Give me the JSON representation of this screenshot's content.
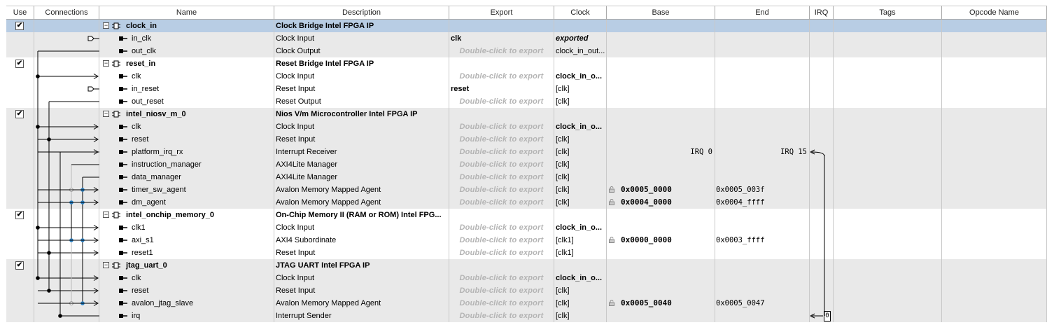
{
  "headers": {
    "use": "Use",
    "connections": "Connections",
    "name": "Name",
    "description": "Description",
    "export": "Export",
    "clock": "Clock",
    "base": "Base",
    "end": "End",
    "irq": "IRQ",
    "tags": "Tags",
    "opcode": "Opcode Name"
  },
  "export_hint": "Double-click to export",
  "rows": [
    {
      "kind": "comp",
      "name": "clock_in",
      "desc": "Clock Bridge Intel FPGA IP",
      "export": "",
      "clock": "",
      "base": "",
      "end": "",
      "checked": true,
      "selected": true
    },
    {
      "kind": "port",
      "name": "in_clk",
      "desc": "Clock Input",
      "export": "clk",
      "clock": "exported",
      "base": "",
      "end": ""
    },
    {
      "kind": "port",
      "name": "out_clk",
      "desc": "Clock Output",
      "export": "",
      "clock": "clock_in_out...",
      "base": "",
      "end": ""
    },
    {
      "kind": "comp",
      "name": "reset_in",
      "desc": "Reset Bridge Intel FPGA IP",
      "export": "",
      "clock": "",
      "base": "",
      "end": "",
      "checked": true
    },
    {
      "kind": "port",
      "name": "clk",
      "desc": "Clock Input",
      "export": "",
      "clock": "clock_in_o...",
      "base": "",
      "end": ""
    },
    {
      "kind": "port",
      "name": "in_reset",
      "desc": "Reset Input",
      "export": "reset",
      "clock": "[clk]",
      "base": "",
      "end": ""
    },
    {
      "kind": "port",
      "name": "out_reset",
      "desc": "Reset Output",
      "export": "",
      "clock": "[clk]",
      "base": "",
      "end": ""
    },
    {
      "kind": "comp",
      "name": "intel_niosv_m_0",
      "desc": "Nios V/m Microcontroller Intel FPGA IP",
      "export": "",
      "clock": "",
      "base": "",
      "end": "",
      "checked": true
    },
    {
      "kind": "port",
      "name": "clk",
      "desc": "Clock Input",
      "export": "",
      "clock": "clock_in_o...",
      "base": "",
      "end": ""
    },
    {
      "kind": "port",
      "name": "reset",
      "desc": "Reset Input",
      "export": "",
      "clock": "[clk]",
      "base": "",
      "end": ""
    },
    {
      "kind": "port",
      "name": "platform_irq_rx",
      "desc": "Interrupt Receiver",
      "export": "",
      "clock": "[clk]",
      "base": "IRQ 0",
      "end": "IRQ 15"
    },
    {
      "kind": "port",
      "name": "instruction_manager",
      "desc": "AXI4Lite Manager",
      "export": "",
      "clock": "[clk]",
      "base": "",
      "end": ""
    },
    {
      "kind": "port",
      "name": "data_manager",
      "desc": "AXI4Lite Manager",
      "export": "",
      "clock": "[clk]",
      "base": "",
      "end": ""
    },
    {
      "kind": "port",
      "name": "timer_sw_agent",
      "desc": "Avalon Memory Mapped Agent",
      "export": "",
      "clock": "[clk]",
      "base": "0x0005_0000",
      "end": "0x0005_003f"
    },
    {
      "kind": "port",
      "name": "dm_agent",
      "desc": "Avalon Memory Mapped Agent",
      "export": "",
      "clock": "[clk]",
      "base": "0x0004_0000",
      "end": "0x0004_ffff"
    },
    {
      "kind": "comp",
      "name": "intel_onchip_memory_0",
      "desc": "On-Chip Memory II (RAM or ROM) Intel FPG...",
      "export": "",
      "clock": "",
      "base": "",
      "end": "",
      "checked": true
    },
    {
      "kind": "port",
      "name": "clk1",
      "desc": "Clock Input",
      "export": "",
      "clock": "clock_in_o...",
      "base": "",
      "end": ""
    },
    {
      "kind": "port",
      "name": "axi_s1",
      "desc": "AXI4 Subordinate",
      "export": "",
      "clock": "[clk1]",
      "base": "0x0000_0000",
      "end": "0x0003_ffff"
    },
    {
      "kind": "port",
      "name": "reset1",
      "desc": "Reset Input",
      "export": "",
      "clock": "[clk1]",
      "base": "",
      "end": ""
    },
    {
      "kind": "comp",
      "name": "jtag_uart_0",
      "desc": "JTAG UART Intel FPGA IP",
      "export": "",
      "clock": "",
      "base": "",
      "end": "",
      "checked": true
    },
    {
      "kind": "port",
      "name": "clk",
      "desc": "Clock Input",
      "export": "",
      "clock": "clock_in_o...",
      "base": "",
      "end": ""
    },
    {
      "kind": "port",
      "name": "reset",
      "desc": "Reset Input",
      "export": "",
      "clock": "[clk]",
      "base": "",
      "end": ""
    },
    {
      "kind": "port",
      "name": "avalon_jtag_slave",
      "desc": "Avalon Memory Mapped Agent",
      "export": "",
      "clock": "[clk]",
      "base": "0x0005_0040",
      "end": "0x0005_0047"
    },
    {
      "kind": "port",
      "name": "irq",
      "desc": "Interrupt Sender",
      "export": "",
      "clock": "[clk]",
      "base": "",
      "end": "",
      "irq_value": "0"
    }
  ],
  "colors": {
    "selected_row": "#b8cde4",
    "component_row": "#e9e9e9",
    "wire": "#000000",
    "connected_dot": "#2a7fc1"
  }
}
